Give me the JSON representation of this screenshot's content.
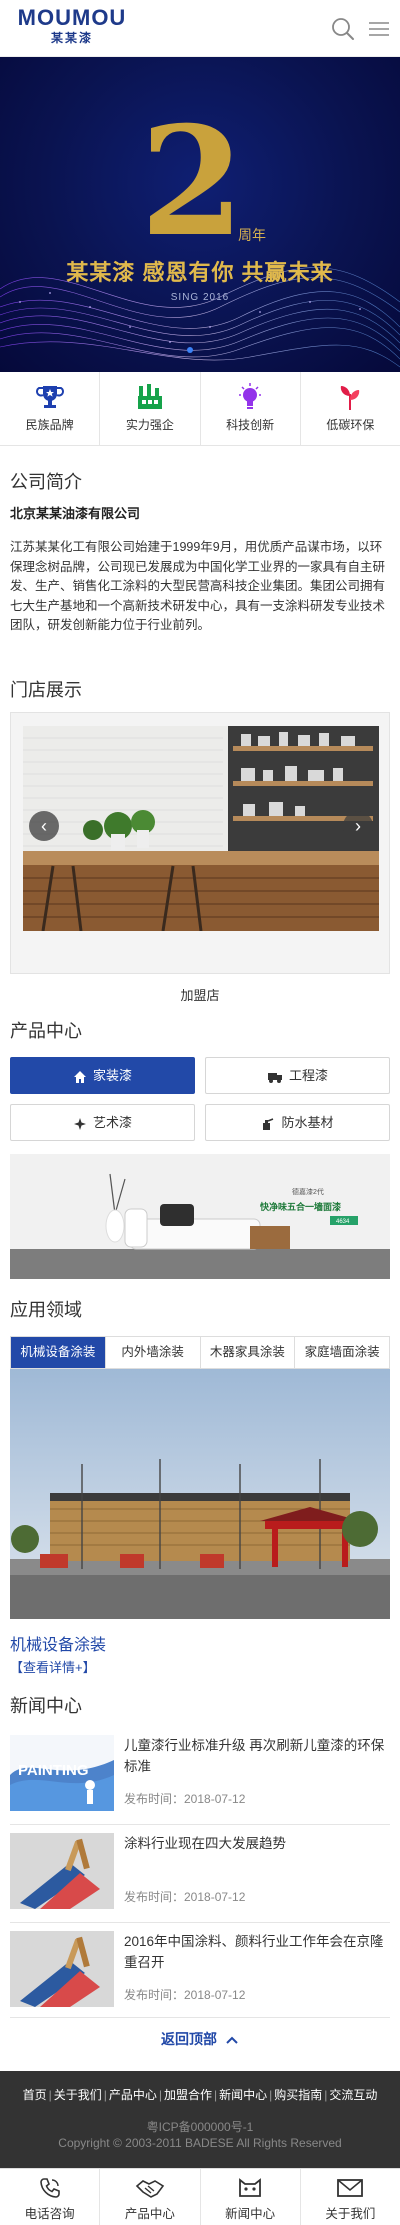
{
  "header": {
    "logo_en": "MOUMOU",
    "logo_cn": "某某漆",
    "search_icon": "search-icon",
    "menu_icon": "menu-icon"
  },
  "banner": {
    "big_number": "2",
    "anniversary": "周年",
    "slogan": "某某漆 感恩有你 共赢未来",
    "sub": "SING 2016",
    "colors": {
      "background": "#0a1350",
      "gold": "#c9a23c"
    }
  },
  "features": [
    {
      "label": "民族品牌",
      "icon": "trophy-icon"
    },
    {
      "label": "实力强企",
      "icon": "factory-icon"
    },
    {
      "label": "科技创新",
      "icon": "lightbulb-icon"
    },
    {
      "label": "低碳环保",
      "icon": "sprout-icon"
    }
  ],
  "about": {
    "title": "公司简介",
    "company": "北京某某油漆有限公司",
    "text": "江苏某某化工有限公司始建于1999年9月，用优质产品谋市场，以环保理念树品牌，公司现已发展成为中国化学工业界的一家具有自主研发、生产、销售化工涂料的大型民营高科技企业集团。集团公司拥有七大生产基地和一个高新技术研发中心，具有一支涂料研发专业技术团队，研发创新能力位于行业前列。"
  },
  "store": {
    "title": "门店展示",
    "caption": "加盟店",
    "prev": "‹",
    "next": "›"
  },
  "products": {
    "title": "产品中心",
    "buttons": [
      {
        "label": "家装漆",
        "icon": "house-icon",
        "active": true
      },
      {
        "label": "工程漆",
        "icon": "truck-icon",
        "active": false
      },
      {
        "label": "艺术漆",
        "icon": "sparkle-icon",
        "active": false
      },
      {
        "label": "防水基材",
        "icon": "sprayer-icon",
        "active": false
      }
    ],
    "banner_line1": "德嘉漆2代",
    "banner_line2": "快净味五合一墙面漆",
    "banner_badge": "4634"
  },
  "applications": {
    "title": "应用领域",
    "tabs": [
      "机械设备涂装",
      "内外墙涂装",
      "木器家具涂装",
      "家庭墙面涂装"
    ],
    "active_tab": 0,
    "caption": "机械设备涂装",
    "more": "【查看详情+】"
  },
  "news": {
    "title": "新闻中心",
    "items": [
      {
        "headline": "儿童漆行业标准升级 再次刷新儿童漆的环保标准",
        "date": "发布时间：2018-07-12",
        "thumb": "PAINTING"
      },
      {
        "headline": "涂料行业现在四大发展趋势",
        "date": "发布时间：2018-07-12"
      },
      {
        "headline": "2016年中国涂料、颜料行业工作年会在京隆重召开",
        "date": "发布时间：2018-07-12"
      }
    ]
  },
  "backtop": "返回顶部",
  "footer": {
    "links": [
      "首页",
      "关于我们",
      "产品中心",
      "加盟合作",
      "新闻中心",
      "购买指南",
      "交流互动"
    ],
    "icp": "粤ICP备000000号-1",
    "copyright": "Copyright © 2003-2011 BADESE All Rights Reserved"
  },
  "bottom_nav": [
    {
      "label": "电话咨询",
      "icon": "phone-icon"
    },
    {
      "label": "产品中心",
      "icon": "handshake-icon"
    },
    {
      "label": "新闻中心",
      "icon": "cat-icon"
    },
    {
      "label": "关于我们",
      "icon": "mail-icon"
    }
  ]
}
